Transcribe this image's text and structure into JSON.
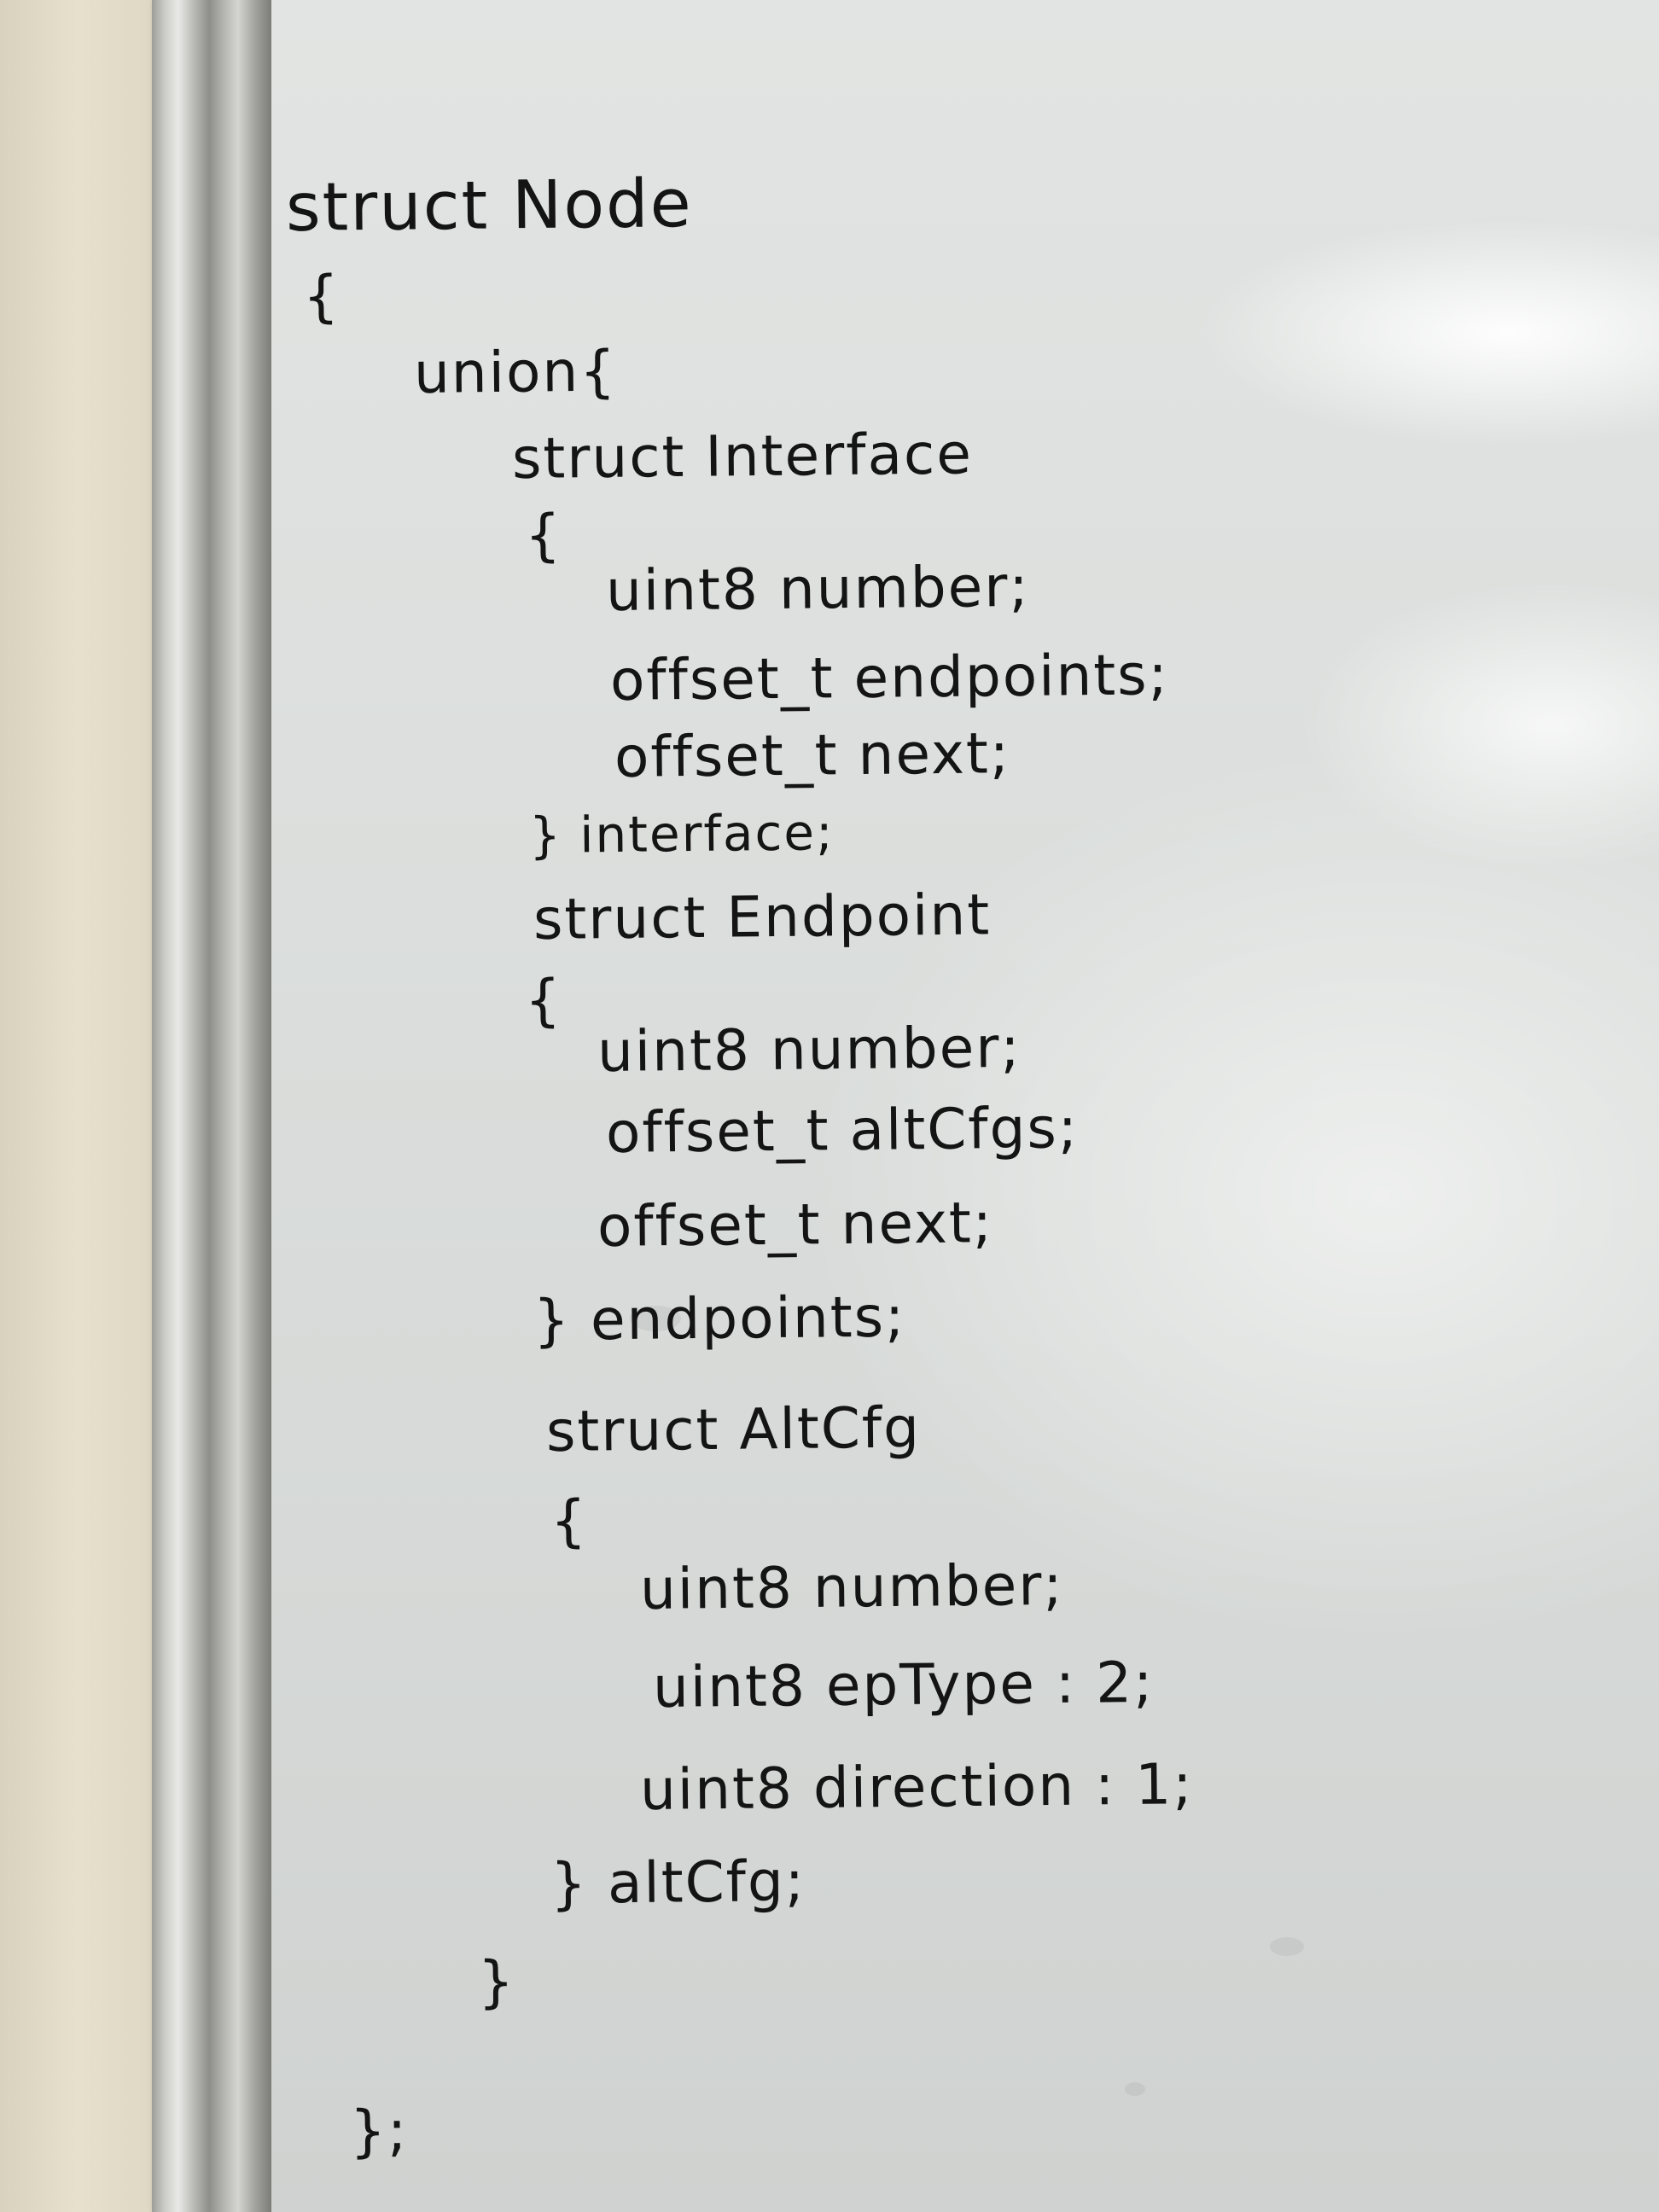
{
  "whiteboard": {
    "lines": [
      "struct Node",
      "{",
      "union{",
      "struct Interface",
      "{",
      "uint8 number;",
      "offset_t endpoints;",
      "offset_t next;",
      "} interface;",
      "struct Endpoint",
      "{",
      "uint8 number;",
      "offset_t altCfgs;",
      "offset_t next;",
      "} endpoints;",
      "struct AltCfg",
      "{",
      "uint8 number;",
      "uint8 epType : 2;",
      "uint8 direction : 1;",
      "} altCfg;",
      "}",
      "};"
    ]
  }
}
